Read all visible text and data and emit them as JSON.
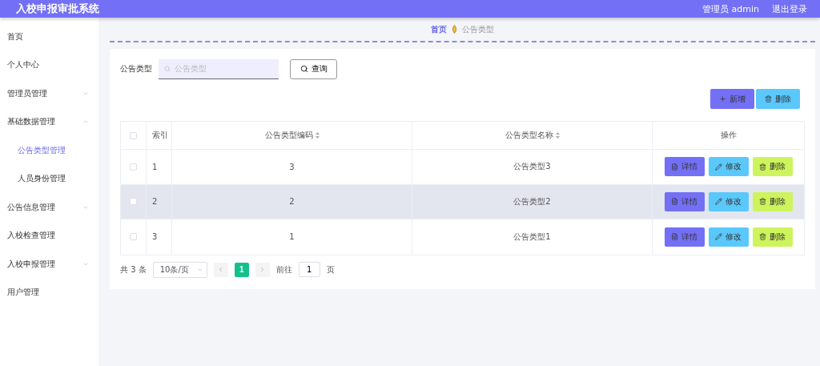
{
  "header": {
    "title": "入校申报审批系统",
    "user": "管理员 admin",
    "logout": "退出登录"
  },
  "sidebar": {
    "items": [
      {
        "label": "首页",
        "kind": "leaf",
        "selected": false
      },
      {
        "label": "个人中心",
        "kind": "leaf",
        "selected": false
      },
      {
        "label": "管理员管理",
        "kind": "submenu",
        "expanded": false
      },
      {
        "label": "基础数据管理",
        "kind": "submenu",
        "expanded": true,
        "children": [
          {
            "label": "公告类型管理",
            "selected": true
          },
          {
            "label": "人员身份管理",
            "selected": false
          }
        ]
      },
      {
        "label": "公告信息管理",
        "kind": "submenu",
        "expanded": false
      },
      {
        "label": "入校检查管理",
        "kind": "leaf",
        "selected": false
      },
      {
        "label": "入校申报管理",
        "kind": "submenu",
        "expanded": false
      },
      {
        "label": "用户管理",
        "kind": "leaf",
        "selected": false
      }
    ]
  },
  "breadcrumb": [
    "首页",
    "公告类型"
  ],
  "search": {
    "label": "公告类型",
    "placeholder": "公告类型",
    "button": "查询"
  },
  "toolbar": [
    "新增",
    "删除"
  ],
  "table": {
    "select_all_checked": false,
    "columns": [
      {
        "label": "索引",
        "sortable": false
      },
      {
        "label": "公告类型编码",
        "sortable": true
      },
      {
        "label": "公告类型名称",
        "sortable": true
      },
      {
        "label": "操作",
        "sortable": false
      }
    ],
    "rows": [
      {
        "index": "1",
        "code": "3",
        "name": "公告类型3",
        "checked": false,
        "hovered": false,
        "actions": [
          "详情",
          "修改",
          "删除"
        ]
      },
      {
        "index": "2",
        "code": "2",
        "name": "公告类型2",
        "checked": false,
        "hovered": true,
        "actions": [
          "详情",
          "修改",
          "删除"
        ]
      },
      {
        "index": "3",
        "code": "1",
        "name": "公告类型1",
        "checked": false,
        "hovered": false,
        "actions": [
          "详情",
          "修改",
          "删除"
        ]
      }
    ]
  },
  "pagination": {
    "total": "共 3 条",
    "page_size": "10条/页",
    "pages": [
      {
        "label": "1",
        "selected": true
      }
    ],
    "goto_label": "前往",
    "goto_value": "1",
    "goto_suffix": "页"
  }
}
